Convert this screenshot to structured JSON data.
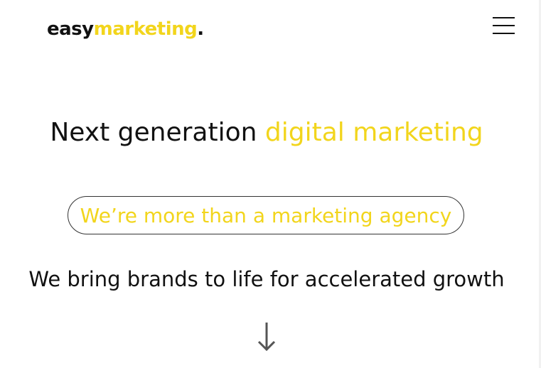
{
  "header": {
    "logo_part1": "easy",
    "logo_part2": "marketing",
    "logo_dot": ".",
    "menu_icon": "hamburger-menu-icon"
  },
  "hero": {
    "headline_plain": "Next generation ",
    "headline_accent": "digital marketing",
    "pill_text": "We’re more than a marketing agency",
    "tagline": "We bring brands to life for accelerated growth",
    "scroll_icon": "arrow-down-icon"
  },
  "colors": {
    "accent": "#f2d51c",
    "text": "#111111",
    "background": "#ffffff"
  }
}
